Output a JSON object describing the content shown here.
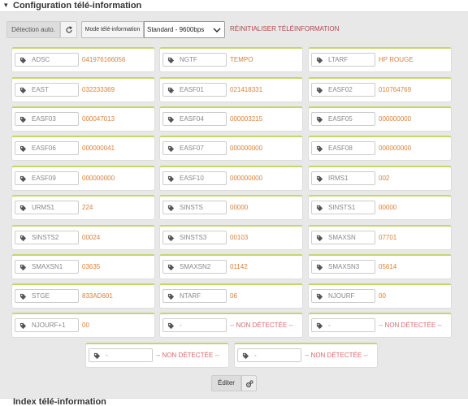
{
  "header": {
    "title": "Configuration télé-information"
  },
  "toolbar": {
    "detect_label": "Détection auto.",
    "mode_label": "Mode télé-information",
    "mode_value": "Standard - 9600bps",
    "reset_label": "RÉINITIALISER TÉLÉINFORMATION"
  },
  "cards": [
    {
      "label": "ADSC",
      "value": "041976166056"
    },
    {
      "label": "NGTF",
      "value": "TEMPO"
    },
    {
      "label": "LTARF",
      "value": "HP ROUGE"
    },
    {
      "label": "EAST",
      "value": "032233369"
    },
    {
      "label": "EASF01",
      "value": "021418331"
    },
    {
      "label": "EASF02",
      "value": "010764769"
    },
    {
      "label": "EASF03",
      "value": "000047013"
    },
    {
      "label": "EASF04",
      "value": "000003215"
    },
    {
      "label": "EASF05",
      "value": "000000000"
    },
    {
      "label": "EASF06",
      "value": "000000041"
    },
    {
      "label": "EASF07",
      "value": "000000000"
    },
    {
      "label": "EASF08",
      "value": "000000000"
    },
    {
      "label": "EASF09",
      "value": "000000000"
    },
    {
      "label": "EASF10",
      "value": "000000000"
    },
    {
      "label": "IRMS1",
      "value": "002"
    },
    {
      "label": "URMS1",
      "value": "224"
    },
    {
      "label": "SINSTS",
      "value": "00000"
    },
    {
      "label": "SINSTS1",
      "value": "00000"
    },
    {
      "label": "SINSTS2",
      "value": "00024"
    },
    {
      "label": "SINSTS3",
      "value": "00103"
    },
    {
      "label": "SMAXSN",
      "value": "07701"
    },
    {
      "label": "SMAXSN1",
      "value": "03635"
    },
    {
      "label": "SMAXSN2",
      "value": "01142"
    },
    {
      "label": "SMAXSN3",
      "value": "05614"
    },
    {
      "label": "STGE",
      "value": "833AD601"
    },
    {
      "label": "NTARF",
      "value": "06"
    },
    {
      "label": "NJOURF",
      "value": "00"
    },
    {
      "label": "NJOURF+1",
      "value": "00"
    },
    {
      "label": "-",
      "value": "-- NON DÉTECTÉE --"
    },
    {
      "label": "-",
      "value": "-- NON DÉTECTÉE --"
    },
    {
      "label": "-",
      "value": "-- NON DÉTECTÉE --"
    },
    {
      "label": "-",
      "value": "-- NON DÉTECTÉE --"
    }
  ],
  "footer": {
    "edit_label": "Éditer"
  },
  "next_section": {
    "title": "Index télé-information"
  },
  "colors": {
    "accent_border": "#c5d66a",
    "value": "#d9813a",
    "not_detected": "#d96a6a",
    "reset": "#b04848"
  }
}
